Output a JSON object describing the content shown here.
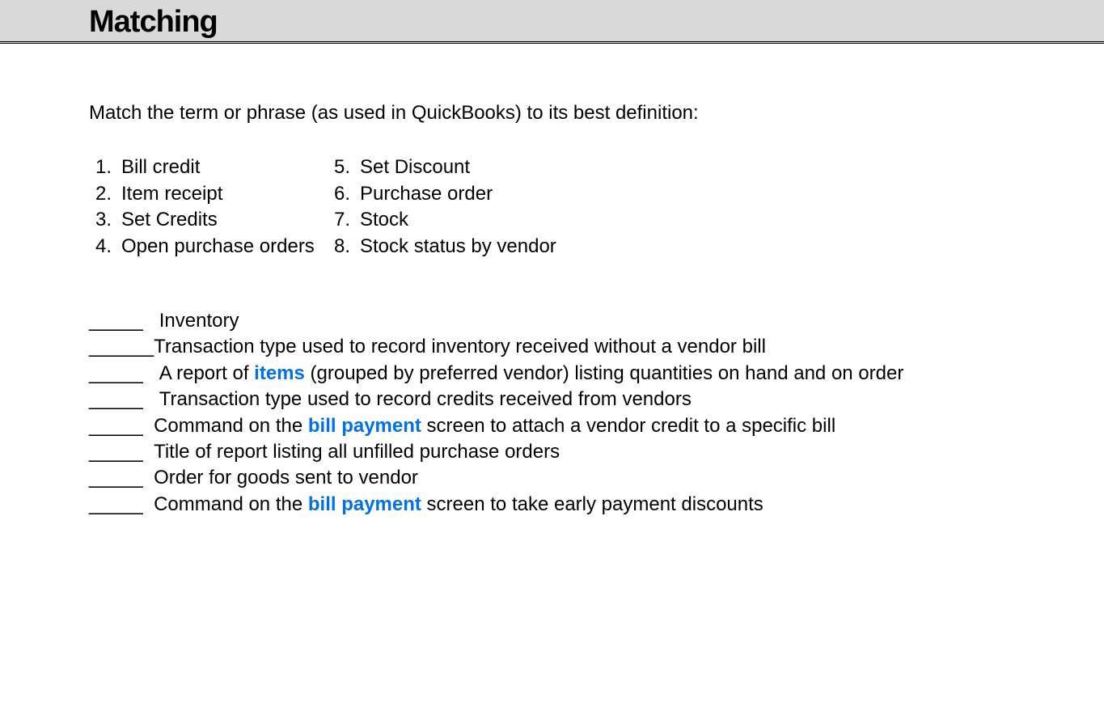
{
  "header": {
    "title": "Matching"
  },
  "instructions": "Match the term or phrase (as used in QuickBooks) to its best definition:",
  "terms": {
    "col1": [
      {
        "num": "1.",
        "label": "Bill credit"
      },
      {
        "num": "2.",
        "label": "Item receipt"
      },
      {
        "num": "3.",
        "label": "Set Credits"
      },
      {
        "num": "4.",
        "label": "Open purchase orders"
      }
    ],
    "col2": [
      {
        "num": "5.",
        "label": "Set Discount"
      },
      {
        "num": "6.",
        "label": "Purchase order"
      },
      {
        "num": "7.",
        "label": "Stock"
      },
      {
        "num": "8.",
        "label": "Stock status by vendor"
      }
    ]
  },
  "definitions": [
    {
      "blank": "_____   ",
      "parts": [
        {
          "text": "Inventory",
          "link": false
        }
      ]
    },
    {
      "blank": "______",
      "parts": [
        {
          "text": "Transaction type used to record inventory received without a vendor bill",
          "link": false
        }
      ]
    },
    {
      "blank": "_____   ",
      "parts": [
        {
          "text": "A report of ",
          "link": false
        },
        {
          "text": "items",
          "link": true
        },
        {
          "text": " (grouped by preferred vendor) listing quantities on hand and on order",
          "link": false
        }
      ]
    },
    {
      "blank": "_____   ",
      "parts": [
        {
          "text": "Transaction type used to record credits received from vendors",
          "link": false
        }
      ]
    },
    {
      "blank": "_____  ",
      "parts": [
        {
          "text": "Command on the ",
          "link": false
        },
        {
          "text": "bill payment",
          "link": true
        },
        {
          "text": " screen to attach a vendor credit to a specific bill",
          "link": false
        }
      ]
    },
    {
      "blank": "_____  ",
      "parts": [
        {
          "text": "Title of report listing all unfilled purchase orders",
          "link": false
        }
      ]
    },
    {
      "blank": "_____  ",
      "parts": [
        {
          "text": "Order for goods sent to vendor",
          "link": false
        }
      ]
    },
    {
      "blank": "_____  ",
      "parts": [
        {
          "text": "Command on the ",
          "link": false
        },
        {
          "text": "bill payment",
          "link": true
        },
        {
          "text": " screen to take early payment discounts",
          "link": false
        }
      ]
    }
  ]
}
